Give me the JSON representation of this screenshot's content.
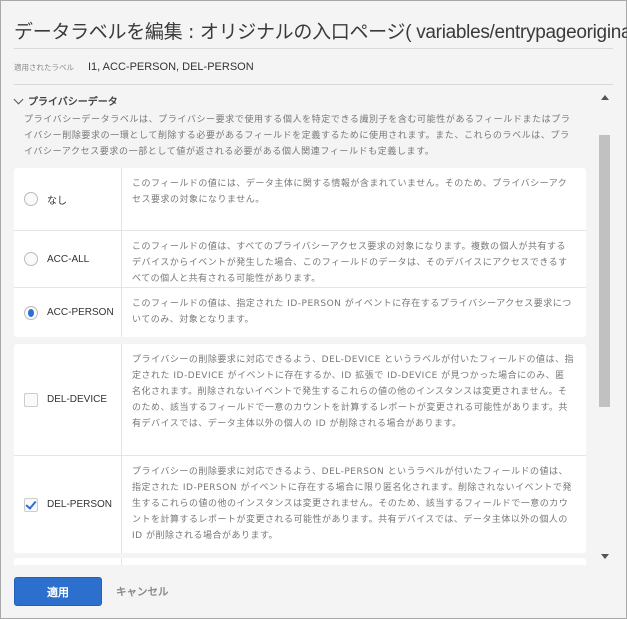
{
  "dialog": {
    "title": "データラベルを編集 : オリジナルの入口ページ",
    "title_path": "( variables/entrypageoriginal )",
    "applied_label": "適用されたラベル",
    "applied_value": "I1, ACC-PERSON, DEL-PERSON"
  },
  "section": {
    "title": "プライバシーデータ",
    "description": "プライバシーデータラベルは、プライバシー要求で使用する個人を特定できる識別子を含む可能性があるフィールドまたはプライバシー削除要求の一環として削除する必要があるフィールドを定義するために使用されます。また、これらのラベルは、プライバシーアクセス要求の一部として値が返される必要がある個人関連フィールドも定義します。"
  },
  "access_options": [
    {
      "name": "なし",
      "selected": false,
      "description": "このフィールドの値には、データ主体に関する情報が含まれていません。そのため、プライバシーアクセス要求の対象になりません。"
    },
    {
      "name": "ACC-ALL",
      "selected": false,
      "description": "このフィールドの値は、すべてのプライバシーアクセス要求の対象になります。複数の個人が共有するデバイスからイベントが発生した場合、このフィールドのデータは、そのデバイスにアクセスできるすべての個人と共有される可能性があります。"
    },
    {
      "name": "ACC-PERSON",
      "selected": true,
      "description": "このフィールドの値は、指定された ID-PERSON がイベントに存在するプライバシーアクセス要求についてのみ、対象となります。"
    }
  ],
  "delete_options": [
    {
      "name": "DEL-DEVICE",
      "checked": false,
      "description": "プライバシーの削除要求に対応できるよう、DEL-DEVICE というラベルが付いたフィールドの値は、指定された ID-DEVICE がイベントに存在するか、ID 拡張で ID-DEVICE が見つかった場合にのみ、匿名化されます。削除されないイベントで発生するこれらの値の他のインスタンスは変更されません。そのため、該当するフィールドで一意のカウントを計算するレポートが変更される可能性があります。共有デバイスでは、データ主体以外の個人の ID が削除される場合があります。"
    },
    {
      "name": "DEL-PERSON",
      "checked": true,
      "description": "プライバシーの削除要求に対応できるよう、DEL-PERSON というラベルが付いたフィールドの値は、指定された ID-PERSON がイベントに存在する場合に限り匿名化されます。削除されないイベントで発生するこれらの値の他のインスタンスは変更されません。そのため、該当するフィールドで一意のカウントを計算するレポートが変更される可能性があります。共有デバイスでは、データ主体以外の個人の ID が削除される場合があります。"
    }
  ],
  "footer": {
    "apply": "適用",
    "cancel": "キャンセル"
  },
  "colors": {
    "accent": "#2d6fcc"
  }
}
